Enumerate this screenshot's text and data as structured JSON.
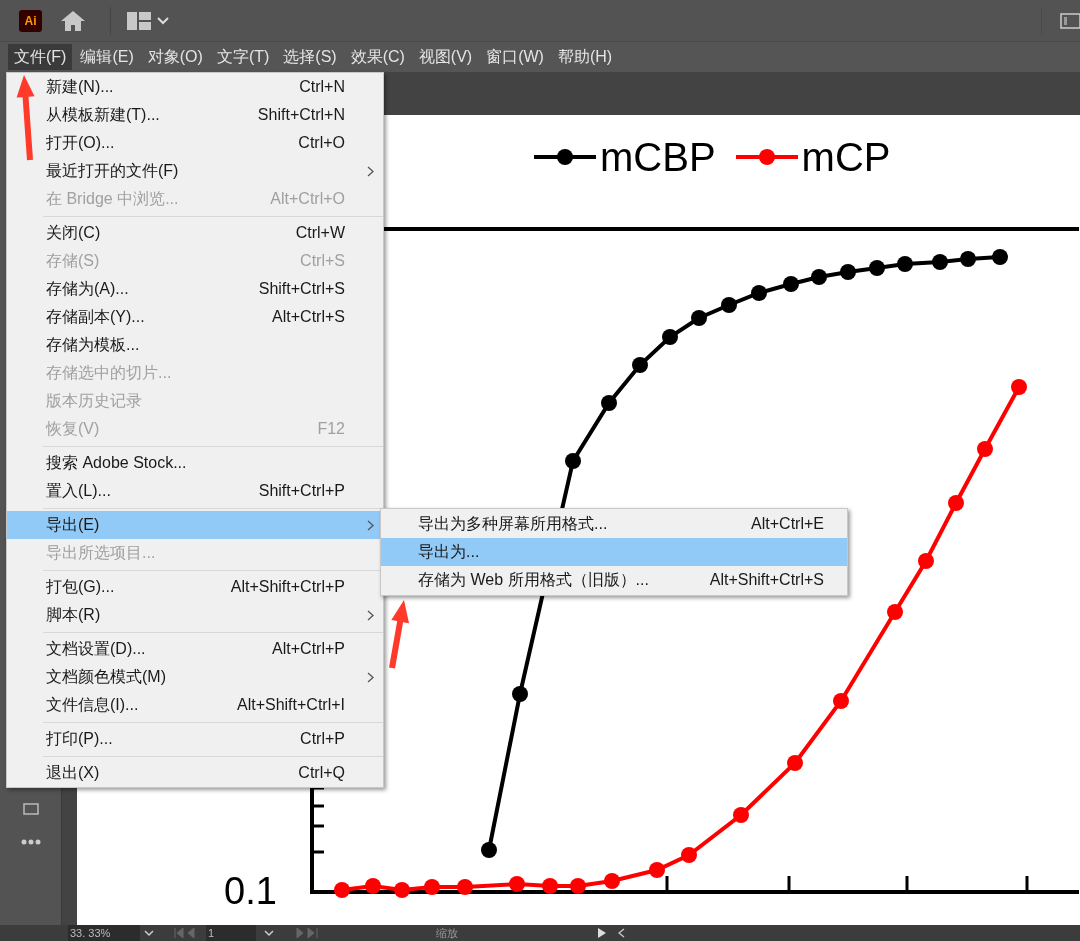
{
  "app_logo": "Ai",
  "menu_bar": [
    {
      "label": "文件(F)",
      "selected": true
    },
    {
      "label": "编辑(E)",
      "selected": false
    },
    {
      "label": "对象(O)",
      "selected": false
    },
    {
      "label": "文字(T)",
      "selected": false
    },
    {
      "label": "选择(S)",
      "selected": false
    },
    {
      "label": "效果(C)",
      "selected": false
    },
    {
      "label": "视图(V)",
      "selected": false
    },
    {
      "label": "窗口(W)",
      "selected": false
    },
    {
      "label": "帮助(H)",
      "selected": false
    }
  ],
  "file_menu": {
    "groups": [
      [
        {
          "label": "新建(N)...",
          "shortcut": "Ctrl+N",
          "disabled": false,
          "selected": false,
          "submenu": false
        },
        {
          "label": "从模板新建(T)...",
          "shortcut": "Shift+Ctrl+N",
          "disabled": false,
          "selected": false,
          "submenu": false
        },
        {
          "label": "打开(O)...",
          "shortcut": "Ctrl+O",
          "disabled": false,
          "selected": false,
          "submenu": false
        },
        {
          "label": "最近打开的文件(F)",
          "disabled": false,
          "selected": false,
          "submenu": true
        },
        {
          "label": "在 Bridge 中浏览...",
          "shortcut": "Alt+Ctrl+O",
          "disabled": true,
          "selected": false,
          "submenu": false
        }
      ],
      [
        {
          "label": "关闭(C)",
          "shortcut": "Ctrl+W",
          "disabled": false,
          "selected": false,
          "submenu": false
        },
        {
          "label": "存储(S)",
          "shortcut": "Ctrl+S",
          "disabled": true,
          "selected": false,
          "submenu": false
        },
        {
          "label": "存储为(A)...",
          "shortcut": "Shift+Ctrl+S",
          "disabled": false,
          "selected": false,
          "submenu": false
        },
        {
          "label": "存储副本(Y)...",
          "shortcut": "Alt+Ctrl+S",
          "disabled": false,
          "selected": false,
          "submenu": false
        },
        {
          "label": "存储为模板...",
          "disabled": false,
          "selected": false,
          "submenu": false
        },
        {
          "label": "存储选中的切片...",
          "disabled": true,
          "selected": false,
          "submenu": false
        },
        {
          "label": "版本历史记录",
          "disabled": true,
          "selected": false,
          "submenu": false
        },
        {
          "label": "恢复(V)",
          "shortcut": "F12",
          "disabled": true,
          "selected": false,
          "submenu": false
        }
      ],
      [
        {
          "label": "搜索 Adobe Stock...",
          "disabled": false,
          "selected": false,
          "submenu": false
        },
        {
          "label": "置入(L)...",
          "shortcut": "Shift+Ctrl+P",
          "disabled": false,
          "selected": false,
          "submenu": false
        }
      ],
      [
        {
          "label": "导出(E)",
          "disabled": false,
          "selected": true,
          "submenu": true
        },
        {
          "label": "导出所选项目...",
          "disabled": true,
          "selected": false,
          "submenu": false
        }
      ],
      [
        {
          "label": "打包(G)...",
          "shortcut": "Alt+Shift+Ctrl+P",
          "disabled": false,
          "selected": false,
          "submenu": false
        },
        {
          "label": "脚本(R)",
          "disabled": false,
          "selected": false,
          "submenu": true
        }
      ],
      [
        {
          "label": "文档设置(D)...",
          "shortcut": "Alt+Ctrl+P",
          "disabled": false,
          "selected": false,
          "submenu": false
        },
        {
          "label": "文档颜色模式(M)",
          "disabled": false,
          "selected": false,
          "submenu": true
        },
        {
          "label": "文件信息(I)...",
          "shortcut": "Alt+Shift+Ctrl+I",
          "disabled": false,
          "selected": false,
          "submenu": false
        }
      ],
      [
        {
          "label": "打印(P)...",
          "shortcut": "Ctrl+P",
          "disabled": false,
          "selected": false,
          "submenu": false
        }
      ],
      [
        {
          "label": "退出(X)",
          "shortcut": "Ctrl+Q",
          "disabled": false,
          "selected": false,
          "submenu": false
        }
      ]
    ]
  },
  "export_submenu": [
    {
      "label": "导出为多种屏幕所用格式...",
      "shortcut": "Alt+Ctrl+E",
      "selected": false
    },
    {
      "label": "导出为...",
      "selected": true
    },
    {
      "label": "存储为 Web 所用格式（旧版）...",
      "shortcut": "Alt+Shift+Ctrl+S",
      "selected": false
    }
  ],
  "canvas": {
    "legend": [
      {
        "label": "mCBP",
        "color": "#000000"
      },
      {
        "label": "mCP",
        "color": "#ff0000"
      }
    ],
    "y_tick_label": "0.1"
  },
  "status_bar": {
    "zoom": "33. 33%",
    "page": "1",
    "label": "缩放"
  }
}
